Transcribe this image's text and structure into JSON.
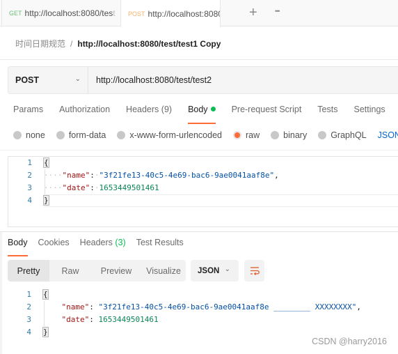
{
  "tabs": [
    {
      "method": "GET",
      "url": "http://localhost:8080/tes",
      "url_fade": "t",
      "unsaved": false
    },
    {
      "method": "POST",
      "url": "http://localhost:8080/",
      "url_fade": "",
      "unsaved": true
    }
  ],
  "tab_actions": {
    "add_icon": "+",
    "more_icon": "•••"
  },
  "breadcrumb": {
    "parent": "时间日期规范",
    "separator": "/",
    "current": "http://localhost:8080/test/test1 Copy"
  },
  "request": {
    "method": "POST",
    "method_chevron": "⌄",
    "url": "http://localhost:8080/test/test2",
    "tabs": [
      {
        "label": "Params"
      },
      {
        "label": "Authorization"
      },
      {
        "label": "Headers",
        "count": "(9)"
      },
      {
        "label": "Body",
        "active": true,
        "indicator": "green-dot"
      },
      {
        "label": "Pre-request Script"
      },
      {
        "label": "Tests"
      },
      {
        "label": "Settings"
      }
    ],
    "body_types": [
      {
        "label": "none",
        "checked": false
      },
      {
        "label": "form-data",
        "checked": false
      },
      {
        "label": "x-www-form-urlencoded",
        "checked": false
      },
      {
        "label": "raw",
        "checked": true
      },
      {
        "label": "binary",
        "checked": false
      },
      {
        "label": "GraphQL",
        "checked": false
      }
    ],
    "body_format_link": "JSON",
    "code": {
      "line_numbers": [
        "1",
        "2",
        "3",
        "4"
      ],
      "open_brace": "{",
      "close_brace": "}",
      "name_key": "\"name\"",
      "name_value": "\"3f21fe13-40c5-4e69-bac6-9ae0041aaf8e\"",
      "date_key": "\"date\"",
      "date_value": "1653449501461"
    }
  },
  "response": {
    "tabs": [
      {
        "label": "Body",
        "active": true
      },
      {
        "label": "Cookies"
      },
      {
        "label": "Headers",
        "count": "(3)"
      },
      {
        "label": "Test Results"
      }
    ],
    "view_modes": [
      {
        "label": "Pretty",
        "active": true
      },
      {
        "label": "Raw"
      },
      {
        "label": "Preview"
      },
      {
        "label": "Visualize"
      }
    ],
    "format": "JSON",
    "format_chevron": "⌄",
    "code": {
      "line_numbers": [
        "1",
        "2",
        "3",
        "4"
      ],
      "open_brace": "{",
      "close_brace": "}",
      "name_key": "\"name\"",
      "name_value": "\"3f21fe13-40c5-4e69-bac6-9ae0041aaf8e ________ XXXXXXXX\"",
      "date_key": "\"date\"",
      "date_value": "1653449501461"
    }
  },
  "watermark": "CSDN @harry2016",
  "colors": {
    "accent": "#ff6c37",
    "success": "#0cbb52",
    "link": "#0265d2"
  }
}
